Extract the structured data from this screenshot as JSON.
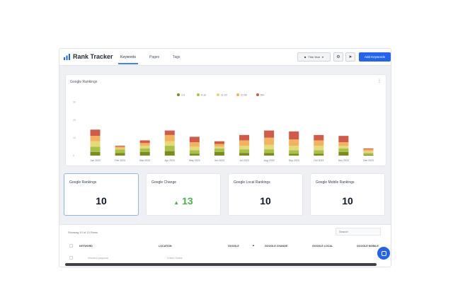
{
  "app": {
    "title": "Rank Tracker"
  },
  "nav": {
    "tabs": [
      {
        "label": "Keywords"
      },
      {
        "label": "Pages"
      },
      {
        "label": "Tags"
      }
    ]
  },
  "toolbar": {
    "time_label": "This Year",
    "add_label": "Add Keywords"
  },
  "chart_card": {
    "title": "Google Rankings"
  },
  "chart_data": {
    "type": "bar",
    "stacked": true,
    "categories": [
      "Jan 2023",
      "Feb 2023",
      "Mar 2023",
      "Apr 2023",
      "May 2023",
      "Jun 2023",
      "Jul 2023",
      "Aug 2023",
      "Sep 2023",
      "Oct 2023",
      "Nov 2023",
      "Dec 2023"
    ],
    "series": [
      {
        "name": "1-3",
        "color": "#7a8b1f",
        "values": [
          2,
          1.5,
          2,
          2.5,
          1,
          2,
          1.5,
          1.5,
          1,
          1,
          2,
          0.5
        ]
      },
      {
        "name": "4-10",
        "color": "#a9c14a",
        "values": [
          3,
          2,
          2,
          3,
          2,
          2,
          2,
          2,
          2,
          2,
          2,
          1
        ]
      },
      {
        "name": "11-20",
        "color": "#e5d97a",
        "values": [
          3,
          0.5,
          1.5,
          2.5,
          2,
          1,
          2,
          2.5,
          2.5,
          2.5,
          1.5,
          1
        ]
      },
      {
        "name": "21-50",
        "color": "#f3b25f",
        "values": [
          3,
          1,
          1.5,
          3.5,
          2.5,
          1.5,
          3,
          4,
          3.5,
          3,
          2,
          1
        ]
      },
      {
        "name": "50+",
        "color": "#cf5b4a",
        "values": [
          3.5,
          0.5,
          1.5,
          2.5,
          3,
          1.5,
          3,
          4,
          4.5,
          3,
          3.5,
          0.5
        ]
      }
    ],
    "ylim": [
      0,
      30
    ],
    "yticks": [
      0,
      10,
      20,
      30
    ],
    "grid": false,
    "legend": "top-center"
  },
  "stats": [
    {
      "title": "Google Rankings",
      "value": "10"
    },
    {
      "title": "Google Change",
      "value": "13"
    },
    {
      "title": "Google Local Rankings",
      "value": "10"
    },
    {
      "title": "Google Mobile Rankings",
      "value": "10"
    }
  ],
  "table": {
    "showing": "Showing 10 of 10 Rows",
    "search_placeholder": "Search",
    "headers": [
      "KEYWORD",
      "LOCATION",
      "GOOGLE",
      "GOOGLE CHANGE",
      "GOOGLE LOCAL",
      "GOOGLE MOBILE"
    ],
    "first_row": {
      "keyword": "research proposal",
      "location": "United States"
    }
  },
  "colors": {
    "accent": "#2563eb",
    "positive": "#4caf50"
  }
}
